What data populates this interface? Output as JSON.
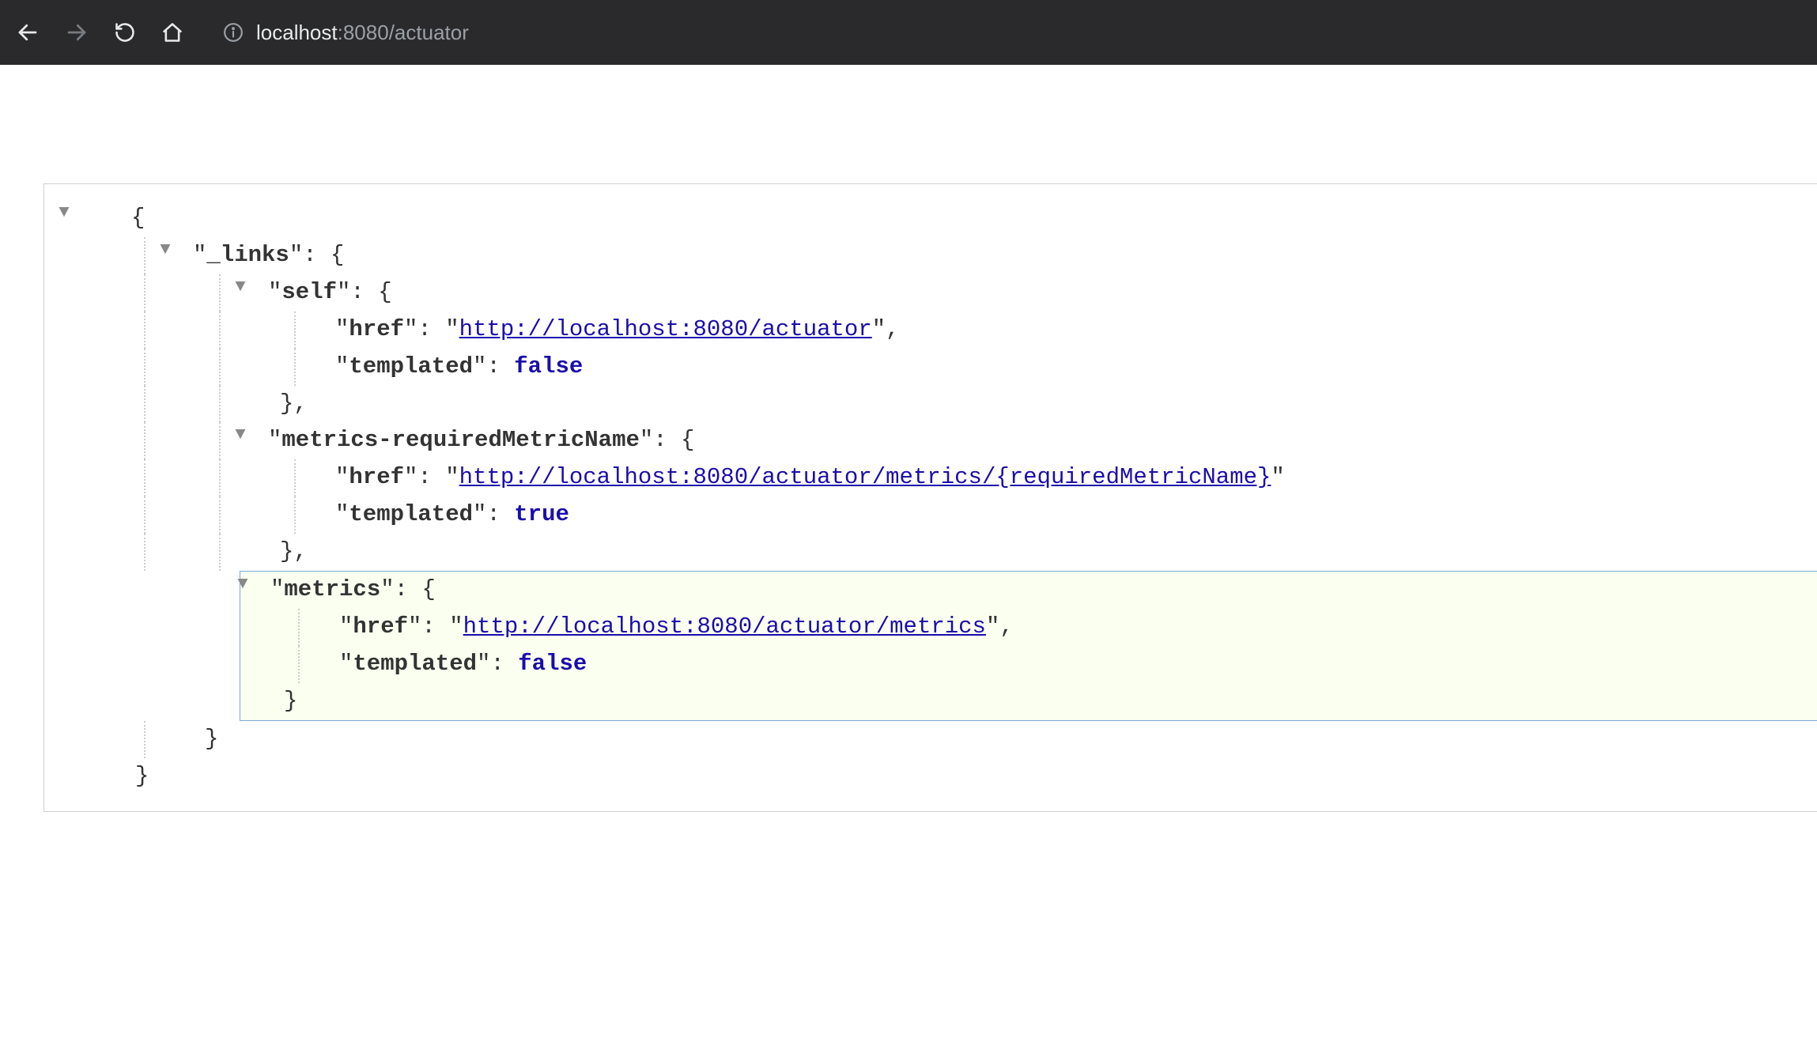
{
  "browser": {
    "url_host": "localhost",
    "url_port": ":8080",
    "url_path": "/actuator"
  },
  "json": {
    "root_key": "_links",
    "entries": [
      {
        "key": "self",
        "href": "http://localhost:8080/actuator",
        "templated": "false",
        "highlighted": false
      },
      {
        "key": "metrics-requiredMetricName",
        "href": "http://localhost:8080/actuator/metrics/{requiredMetricName}",
        "templated": "true",
        "highlighted": false
      },
      {
        "key": "metrics",
        "href": "http://localhost:8080/actuator/metrics",
        "templated": "false",
        "highlighted": true
      }
    ],
    "href_label": "href",
    "templated_label": "templated"
  }
}
